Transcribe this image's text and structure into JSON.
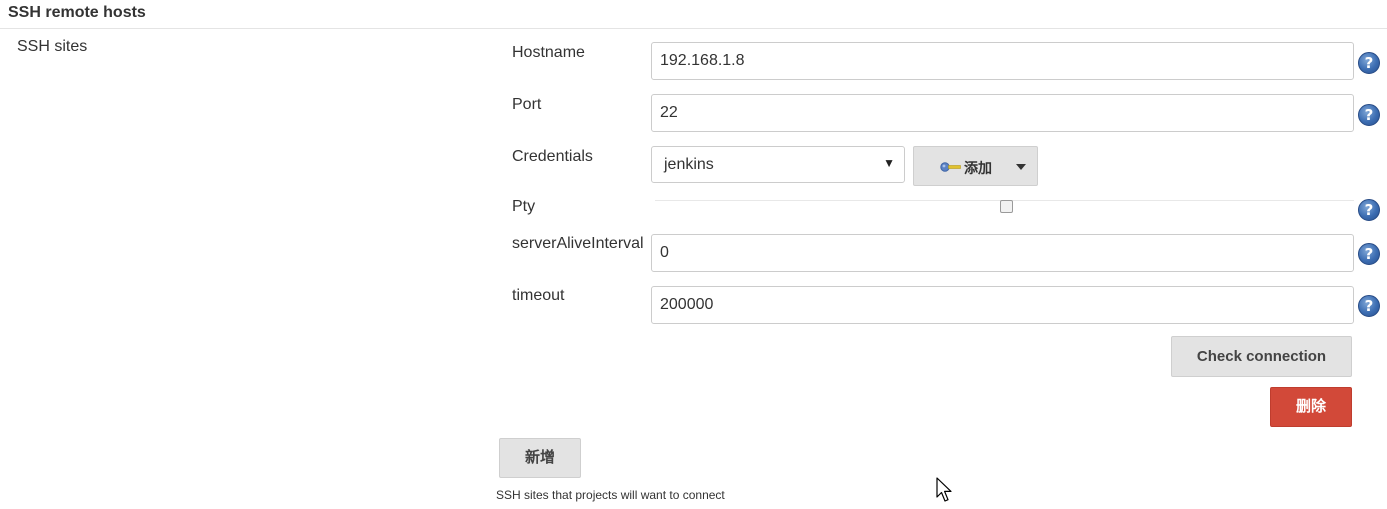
{
  "section": {
    "title": "SSH remote hosts"
  },
  "sites_label": "SSH sites",
  "fields": {
    "hostname": {
      "label": "Hostname",
      "value": "192.168.1.8"
    },
    "port": {
      "label": "Port",
      "value": "22"
    },
    "credentials": {
      "label": "Credentials",
      "selected": "jenkins",
      "add_label": "添加"
    },
    "pty": {
      "label": "Pty",
      "checked": false
    },
    "server_alive": {
      "label": "serverAliveInterval",
      "value": "0"
    },
    "timeout": {
      "label": "timeout",
      "value": "200000"
    }
  },
  "help_glyph": "?",
  "buttons": {
    "check_connection": "Check connection",
    "delete": "删除",
    "add_new": "新增"
  },
  "description": "SSH sites that projects will want to connect",
  "icons": {
    "help": "help-icon",
    "credentials_add": "key-icon",
    "dropdown": "caret-down-icon",
    "cursor": "mouse-pointer-icon"
  },
  "colors": {
    "delete_button": "#d24939",
    "help_icon": "#3c6db2",
    "neutral_button": "#e3e3e3"
  }
}
